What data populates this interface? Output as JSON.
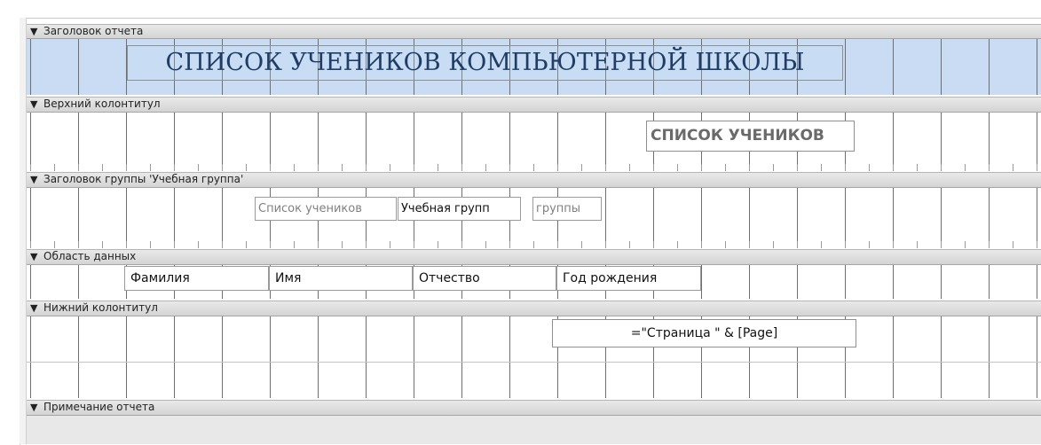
{
  "sections": {
    "report_header": {
      "label": "Заголовок отчета",
      "title": "СПИСОК УЧЕНИКОВ КОМПЬЮТЕРНОЙ ШКОЛЫ"
    },
    "page_header": {
      "label": "Верхний колонтитул",
      "title": "СПИСОК УЧЕНИКОВ"
    },
    "group_header": {
      "label": "Заголовок группы 'Учебная группа'",
      "students_list_label": "Список учеников",
      "group_field": "Учебная групп",
      "groups_label": "группы"
    },
    "detail": {
      "label": "Область данных",
      "fields": [
        "Фамилия",
        "Имя",
        "Отчество",
        "Год рождения"
      ]
    },
    "page_footer": {
      "label": "Нижний колонтитул",
      "page_expression": "=\"Страница \" & [Page]"
    },
    "report_footer": {
      "label": "Примечание отчета"
    }
  },
  "icons": {
    "section_bar": "section-collapse-icon"
  },
  "colors": {
    "report_header_bg": "#c9dcf3",
    "title_text": "#1f3d66",
    "section_bar_bg": "#dcdcdc"
  }
}
